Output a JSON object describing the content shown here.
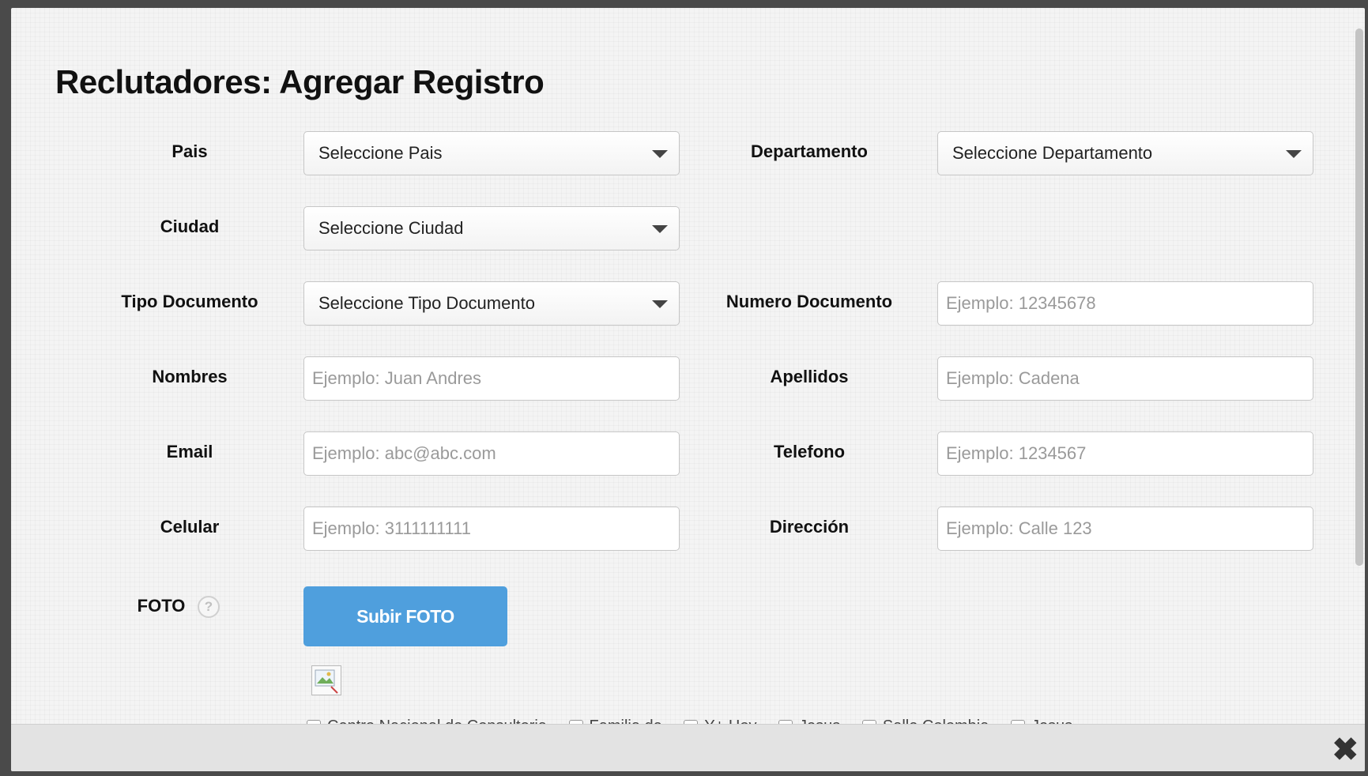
{
  "modal": {
    "title": "Reclutadores: Agregar Registro",
    "close_icon": "close-icon"
  },
  "form": {
    "pais": {
      "label": "Pais",
      "value": "Seleccione Pais"
    },
    "departamento": {
      "label": "Departamento",
      "value": "Seleccione Departamento"
    },
    "ciudad": {
      "label": "Ciudad",
      "value": "Seleccione Ciudad"
    },
    "tipo_documento": {
      "label": "Tipo Documento",
      "value": "Seleccione Tipo Documento"
    },
    "numero_documento": {
      "label": "Numero Documento",
      "placeholder": "Ejemplo: 12345678"
    },
    "nombres": {
      "label": "Nombres",
      "placeholder": "Ejemplo: Juan Andres"
    },
    "apellidos": {
      "label": "Apellidos",
      "placeholder": "Ejemplo: Cadena"
    },
    "email": {
      "label": "Email",
      "placeholder": "Ejemplo: abc@abc.com"
    },
    "telefono": {
      "label": "Telefono",
      "placeholder": "Ejemplo: 1234567"
    },
    "celular": {
      "label": "Celular",
      "placeholder": "Ejemplo: 3111111111"
    },
    "direccion": {
      "label": "Dirección",
      "placeholder": "Ejemplo: Calle 123"
    },
    "foto": {
      "label": "FOTO",
      "help": "?",
      "upload_label": "Subir FOTO"
    },
    "checkbox_options": [
      "Centro Nacional de Consultoria",
      "Familia de",
      "Y+ Hoy",
      "Jesus",
      "Salle Colombia",
      "Jesus"
    ]
  },
  "icons": {
    "dropdown": "chevron-down-icon",
    "help": "help-icon",
    "image": "broken-image-icon"
  }
}
